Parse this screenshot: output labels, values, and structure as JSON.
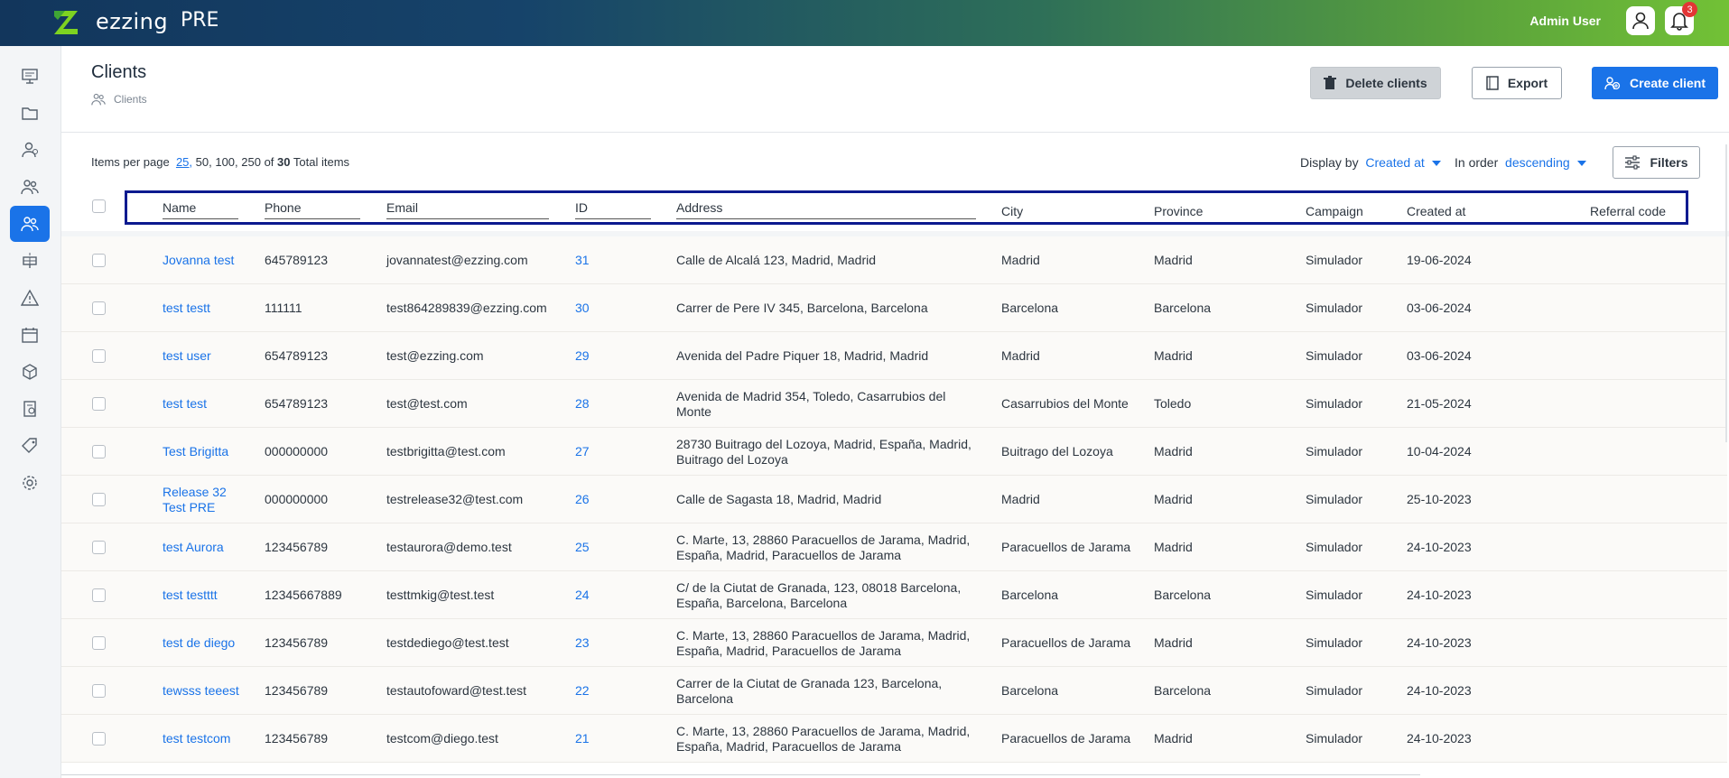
{
  "app": {
    "brand": "ezzing",
    "env": "PRE",
    "user": "Admin User",
    "notifications": "3"
  },
  "sidebar": {
    "items": [
      "dashboard-icon",
      "folder-icon",
      "leads-icon",
      "team-icon",
      "clients-icon",
      "solar-icon",
      "warning-icon",
      "calendar-icon",
      "package-icon",
      "billing-icon",
      "tag-icon",
      "settings-icon"
    ],
    "active": 4
  },
  "page": {
    "title": "Clients",
    "breadcrumb": "Clients"
  },
  "actions": {
    "delete": "Delete clients",
    "export": "Export",
    "create": "Create client"
  },
  "pager": {
    "label": "Items per page",
    "selected": "25,",
    "options": "50, 100, 250",
    "of": "of",
    "total": "30",
    "suffix": "Total items"
  },
  "sort": {
    "display_label": "Display by",
    "display_value": "Created at",
    "order_label": "In order",
    "order_value": "descending",
    "filters": "Filters"
  },
  "columns": [
    "Name",
    "Phone",
    "Email",
    "ID",
    "Address",
    "City",
    "Province",
    "Campaign",
    "Created at",
    "Referral code"
  ],
  "rows": [
    {
      "name": "Jovanna test",
      "phone": "645789123",
      "email": "jovannatest@ezzing.com",
      "id": "31",
      "address": "Calle de Alcalá 123, Madrid, Madrid",
      "city": "Madrid",
      "province": "Madrid",
      "campaign": "Simulador",
      "created": "19-06-2024"
    },
    {
      "name": "test testt",
      "phone": "111111",
      "email": "test864289839@ezzing.com",
      "id": "30",
      "address": "Carrer de Pere IV 345, Barcelona, Barcelona",
      "city": "Barcelona",
      "province": "Barcelona",
      "campaign": "Simulador",
      "created": "03-06-2024"
    },
    {
      "name": "test user",
      "phone": "654789123",
      "email": "test@ezzing.com",
      "id": "29",
      "address": "Avenida del Padre Piquer 18, Madrid, Madrid",
      "city": "Madrid",
      "province": "Madrid",
      "campaign": "Simulador",
      "created": "03-06-2024"
    },
    {
      "name": "test test",
      "phone": "654789123",
      "email": "test@test.com",
      "id": "28",
      "address": "Avenida de Madrid 354, Toledo, Casarrubios del Monte",
      "city": "Casarrubios del Monte",
      "province": "Toledo",
      "campaign": "Simulador",
      "created": "21-05-2024"
    },
    {
      "name": "Test Brigitta",
      "phone": "000000000",
      "email": "testbrigitta@test.com",
      "id": "27",
      "address": "28730 Buitrago del Lozoya, Madrid, España, Madrid, Buitrago del Lozoya",
      "city": "Buitrago del Lozoya",
      "province": "Madrid",
      "campaign": "Simulador",
      "created": "10-04-2024"
    },
    {
      "name": "Release 32 Test PRE",
      "phone": "000000000",
      "email": "testrelease32@test.com",
      "id": "26",
      "address": "Calle de Sagasta 18, Madrid, Madrid",
      "city": "Madrid",
      "province": "Madrid",
      "campaign": "Simulador",
      "created": "25-10-2023"
    },
    {
      "name": "test Aurora",
      "phone": "123456789",
      "email": "testaurora@demo.test",
      "id": "25",
      "address": "C. Marte, 13, 28860 Paracuellos de Jarama, Madrid, España, Madrid, Paracuellos de Jarama",
      "city": "Paracuellos de Jarama",
      "province": "Madrid",
      "campaign": "Simulador",
      "created": "24-10-2023"
    },
    {
      "name": "test testttt",
      "phone": "12345667889",
      "email": "testtmkig@test.test",
      "id": "24",
      "address": "C/ de la Ciutat de Granada, 123, 08018 Barcelona, España, Barcelona, Barcelona",
      "city": "Barcelona",
      "province": "Barcelona",
      "campaign": "Simulador",
      "created": "24-10-2023"
    },
    {
      "name": "test de diego",
      "phone": "123456789",
      "email": "testdediego@test.test",
      "id": "23",
      "address": "C. Marte, 13, 28860 Paracuellos de Jarama, Madrid, España, Madrid, Paracuellos de Jarama",
      "city": "Paracuellos de Jarama",
      "province": "Madrid",
      "campaign": "Simulador",
      "created": "24-10-2023"
    },
    {
      "name": "tewsss teeest",
      "phone": "123456789",
      "email": "testautofoward@test.test",
      "id": "22",
      "address": "Carrer de la Ciutat de Granada 123, Barcelona, Barcelona",
      "city": "Barcelona",
      "province": "Barcelona",
      "campaign": "Simulador",
      "created": "24-10-2023"
    },
    {
      "name": "test testcom",
      "phone": "123456789",
      "email": "testcom@diego.test",
      "id": "21",
      "address": "C. Marte, 13, 28860 Paracuellos de Jarama, Madrid, España, Madrid, Paracuellos de Jarama",
      "city": "Paracuellos de Jarama",
      "province": "Madrid",
      "campaign": "Simulador",
      "created": "24-10-2023"
    }
  ]
}
